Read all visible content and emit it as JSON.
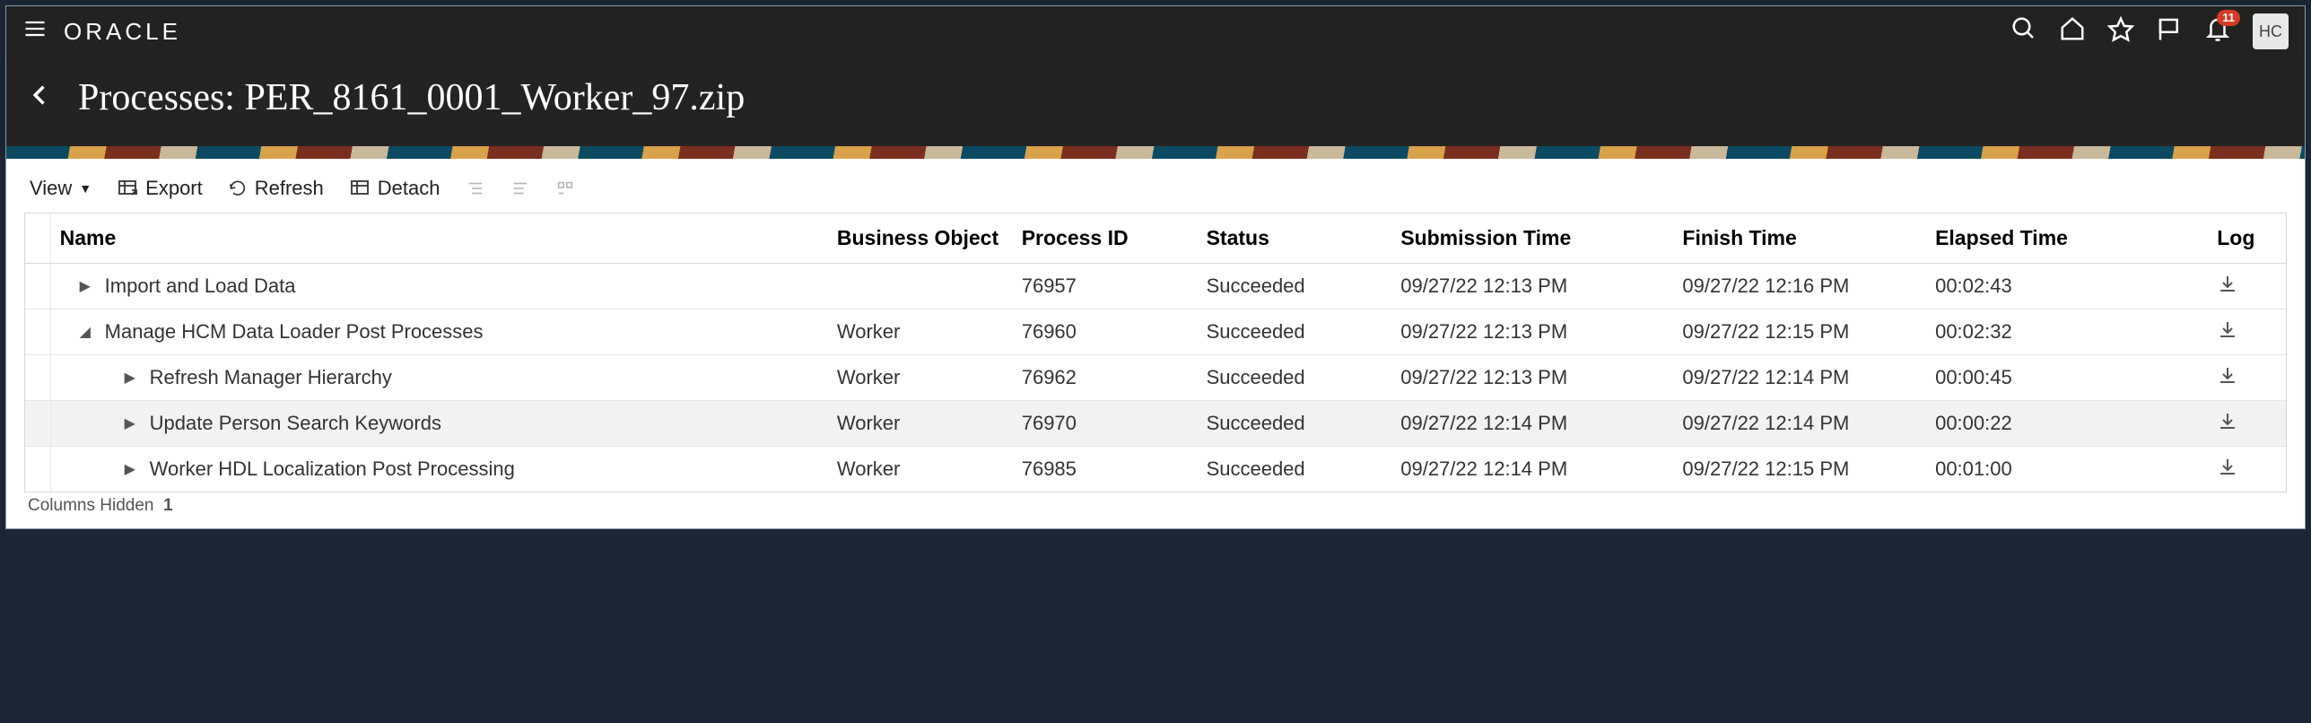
{
  "topbar": {
    "logo_text": "ORACLE",
    "notification_count": "11",
    "avatar_initials": "HC"
  },
  "header": {
    "page_title": "Processes: PER_8161_0001_Worker_97.zip"
  },
  "toolbar": {
    "view_label": "View",
    "export_label": "Export",
    "refresh_label": "Refresh",
    "detach_label": "Detach"
  },
  "table": {
    "columns": {
      "name": "Name",
      "business_object": "Business Object",
      "process_id": "Process ID",
      "status": "Status",
      "submission_time": "Submission Time",
      "finish_time": "Finish Time",
      "elapsed_time": "Elapsed Time",
      "log": "Log"
    },
    "rows": [
      {
        "indent": 0,
        "expanded": false,
        "name": "Import and Load Data",
        "business_object": "",
        "process_id": "76957",
        "status": "Succeeded",
        "submission_time": "09/27/22 12:13 PM",
        "finish_time": "09/27/22 12:16 PM",
        "elapsed_time": "00:02:43"
      },
      {
        "indent": 0,
        "expanded": true,
        "name": "Manage HCM Data Loader Post Processes",
        "business_object": "Worker",
        "process_id": "76960",
        "status": "Succeeded",
        "submission_time": "09/27/22 12:13 PM",
        "finish_time": "09/27/22 12:15 PM",
        "elapsed_time": "00:02:32"
      },
      {
        "indent": 1,
        "expanded": false,
        "name": "Refresh Manager Hierarchy",
        "business_object": "Worker",
        "process_id": "76962",
        "status": "Succeeded",
        "submission_time": "09/27/22 12:13 PM",
        "finish_time": "09/27/22 12:14 PM",
        "elapsed_time": "00:00:45"
      },
      {
        "indent": 1,
        "expanded": false,
        "highlight": true,
        "name": "Update Person Search Keywords",
        "business_object": "Worker",
        "process_id": "76970",
        "status": "Succeeded",
        "submission_time": "09/27/22 12:14 PM",
        "finish_time": "09/27/22 12:14 PM",
        "elapsed_time": "00:00:22"
      },
      {
        "indent": 1,
        "expanded": false,
        "name": "Worker HDL Localization Post Processing",
        "business_object": "Worker",
        "process_id": "76985",
        "status": "Succeeded",
        "submission_time": "09/27/22 12:14 PM",
        "finish_time": "09/27/22 12:15 PM",
        "elapsed_time": "00:01:00"
      }
    ]
  },
  "footer": {
    "columns_hidden_label": "Columns Hidden",
    "columns_hidden_count": "1"
  }
}
